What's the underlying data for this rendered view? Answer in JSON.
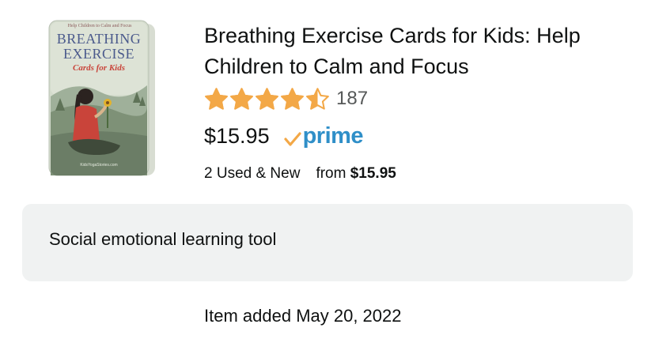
{
  "product": {
    "cover_banner": "Help Children to Calm and Focus",
    "cover_title_line1": "BREATHING",
    "cover_title_line2": "EXERCISE",
    "cover_subtitle": "Cards for Kids",
    "cover_footer": "KidsYogaStories.com",
    "title": "Breathing Exercise Cards for Kids: Help Children to Calm and Focus",
    "rating": 4.5,
    "review_count": "187",
    "price": "$15.95",
    "prime_label": "prime",
    "offers_label": "2 Used & New",
    "offers_from_label": "from",
    "offers_from_price": "$15.95"
  },
  "note": {
    "text": "Social emotional learning tool"
  },
  "item_added": "Item added May 20, 2022",
  "colors": {
    "star": "#f3a847",
    "prime_blue": "#2f8fc8",
    "prime_check": "#f3a847",
    "pill_bg": "#f0f2f2"
  },
  "icons": [
    "star-icon",
    "half-star-icon",
    "prime-check-icon"
  ]
}
